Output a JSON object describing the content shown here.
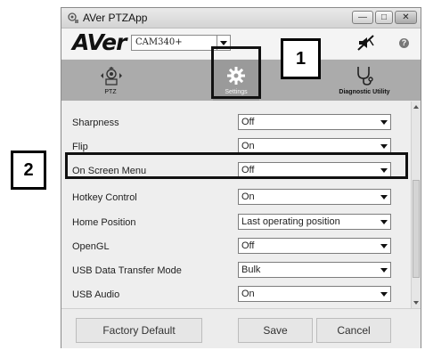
{
  "window": {
    "title": "AVer PTZApp",
    "controls": {
      "minimize": "—",
      "maximize": "□",
      "close": "✕"
    }
  },
  "brand": {
    "logo_text": "AVer",
    "camera_select_value": "CAM340+",
    "icons": {
      "mute": "speaker-muted-icon",
      "help": "help-icon"
    },
    "help_glyph": "?"
  },
  "nav": {
    "items": [
      {
        "id": "ptz",
        "label": "PTZ",
        "icon": "ptz-camera-icon"
      },
      {
        "id": "settings",
        "label": "Settings",
        "icon": "gear-icon"
      },
      {
        "id": "diagnostic",
        "label": "Diagnostic Utility",
        "icon": "stethoscope-icon"
      }
    ]
  },
  "settings": [
    {
      "label": "Sharpness",
      "value": "Off"
    },
    {
      "label": "Flip",
      "value": "On"
    },
    {
      "label": "On Screen Menu",
      "value": "Off"
    },
    {
      "label": "Hotkey Control",
      "value": "On"
    },
    {
      "label": "Home Position",
      "value": "Last operating position"
    },
    {
      "label": "OpenGL",
      "value": "Off"
    },
    {
      "label": "USB Data Transfer Mode",
      "value": "Bulk"
    },
    {
      "label": "USB Audio",
      "value": "On"
    }
  ],
  "footer": {
    "factory_default_label": "Factory Default",
    "save_label": "Save",
    "cancel_label": "Cancel"
  },
  "callouts": {
    "one": "1",
    "two": "2"
  },
  "colors": {
    "nav_bg": "#ababab",
    "nav_active": "#9a9a9a",
    "content_bg": "#eeeeee"
  }
}
